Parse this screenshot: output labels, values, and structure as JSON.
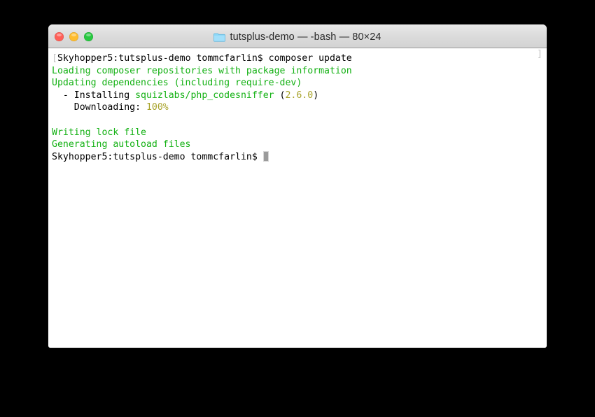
{
  "window": {
    "title_text": "tutsplus-demo — -bash — 80×24",
    "folder_icon_name": "folder-icon",
    "controls": {
      "close_label": "",
      "minimize_label": "",
      "maximize_label": ""
    }
  },
  "colors": {
    "prompt_text": "#000000",
    "output_green": "#13b113",
    "output_yellow": "#a8a32a",
    "titlebar_bg": "#dcdcdc",
    "terminal_bg": "#ffffff",
    "traffic_red": "#ff5f57",
    "traffic_yellow": "#febc2e",
    "traffic_green": "#28c840",
    "folder_blue": "#7fd4f5"
  },
  "terminal": {
    "bracket_open": "[",
    "bracket_close": "]",
    "lines": [
      {
        "id": "line-prompt-command",
        "segments": [
          {
            "text": "Skyhopper5:tutsplus-demo tommcfarlin$ composer update",
            "color": "default"
          }
        ]
      },
      {
        "id": "line-loading-repos",
        "segments": [
          {
            "text": "Loading composer repositories with package information",
            "color": "green"
          }
        ]
      },
      {
        "id": "line-updating-deps",
        "segments": [
          {
            "text": "Updating dependencies (including require-dev)",
            "color": "green"
          }
        ]
      },
      {
        "id": "line-installing-package",
        "segments": [
          {
            "text": "  - Installing ",
            "color": "default"
          },
          {
            "text": "squizlabs/php_codesniffer",
            "color": "green"
          },
          {
            "text": " (",
            "color": "default"
          },
          {
            "text": "2.6.0",
            "color": "yellow"
          },
          {
            "text": ")",
            "color": "default"
          }
        ]
      },
      {
        "id": "line-downloading",
        "segments": [
          {
            "text": "    Downloading: ",
            "color": "default"
          },
          {
            "text": "100%",
            "color": "yellow"
          }
        ]
      },
      {
        "id": "line-blank-1",
        "segments": [
          {
            "text": " ",
            "color": "default"
          }
        ]
      },
      {
        "id": "line-writing-lock",
        "segments": [
          {
            "text": "Writing lock file",
            "color": "green"
          }
        ]
      },
      {
        "id": "line-generating-autoload",
        "segments": [
          {
            "text": "Generating autoload files",
            "color": "green"
          }
        ]
      },
      {
        "id": "line-final-prompt",
        "segments": [
          {
            "text": "Skyhopper5:tutsplus-demo tommcfarlin$ ",
            "color": "default"
          }
        ],
        "cursor": true
      }
    ]
  }
}
